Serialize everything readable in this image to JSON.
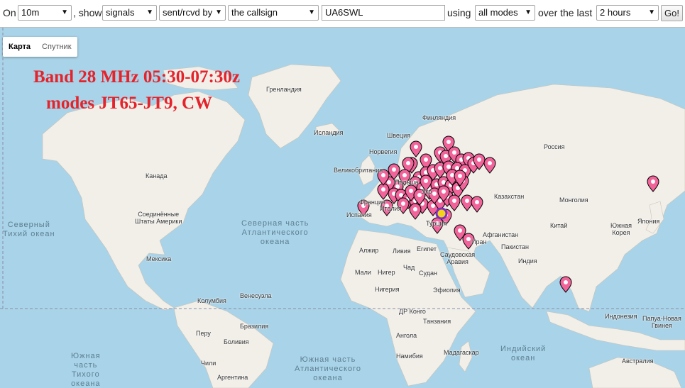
{
  "toolbar": {
    "on_label": "On",
    "band_value": "10m",
    "show_label": ", show",
    "show_value": "signals",
    "direction_value": "sent/rcvd by",
    "target_value": "the callsign",
    "callsign_value": "UA6SWL",
    "using_label": "using",
    "mode_value": "all modes",
    "over_label": "over the last",
    "period_value": "2 hours",
    "go_label": "Go!"
  },
  "map_type": {
    "map": "Карта",
    "satellite": "Спутник"
  },
  "overlay": {
    "line1": "Band 28 MHz 05:30-07:30z",
    "line2": "modes JT65-JT9, CW"
  },
  "labels": {
    "greenland": "Гренландия",
    "iceland": "Исландия",
    "sweden": "Швеция",
    "norway": "Норвегия",
    "finland": "Финляндия",
    "russia": "Россия",
    "uk": "Великобритания",
    "poland": "Польша",
    "ukraine": "Укр",
    "france": "Франция",
    "spain": "Испания",
    "italy": "Италия",
    "kazakhstan": "Казахстан",
    "mongolia": "Монголия",
    "china": "Китай",
    "japan": "Япония",
    "south_korea": "Южная\nКорея",
    "turkey": "Турция",
    "iran": "Иран",
    "afghanistan": "Афганистан",
    "pakistan": "Пакистан",
    "india": "Индия",
    "egypt": "Египет",
    "saudi": "Саудовская\nАравия",
    "algeria": "Алжир",
    "libya": "Ливия",
    "mali": "Мали",
    "niger": "Нигер",
    "chad": "Чад",
    "sudan": "Судан",
    "nigeria": "Нигерия",
    "ethiopia": "Эфиопия",
    "drc": "ДР Конго",
    "tanzania": "Танзания",
    "angola": "Ангола",
    "namibia": "Намибия",
    "madagascar": "Мадагаскар",
    "canada": "Канада",
    "usa": "Соединённые\nШтаты Америки",
    "mexico": "Мексика",
    "venezuela": "Венесуэла",
    "colombia": "Колумбия",
    "peru": "Перу",
    "brazil": "Бразилия",
    "bolivia": "Боливия",
    "argentina": "Аргентина",
    "chile": "Чили",
    "indonesia": "Индонезия",
    "png": "Папуа-Новая\nГвинея",
    "australia": "Австралия"
  },
  "oceans": {
    "north_pacific": [
      "Северный",
      "Тихий океан"
    ],
    "north_atlantic": [
      "Северная часть",
      "Атлантического",
      "океана"
    ],
    "south_pacific": [
      "Южная",
      "часть",
      "Тихого",
      "океана"
    ],
    "south_atlantic": [
      "Южная часть",
      "Атлантического",
      "океана"
    ],
    "indian": [
      "Индийский",
      "океан"
    ]
  },
  "colors": {
    "marker": "#f0649a",
    "marker_outline": "#000000",
    "water": "#a9d3e8",
    "land": "#f2efe9",
    "overlay_text": "#e4232b"
  }
}
